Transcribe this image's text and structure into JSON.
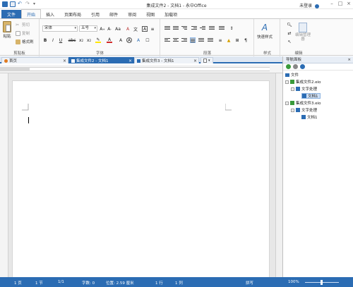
{
  "window": {
    "title": "集成文件2 - 文档1 - 永中Office",
    "user": "未登录"
  },
  "ribbon_tabs": [
    "文件",
    "开始",
    "插入",
    "页面布局",
    "引用",
    "邮件",
    "审阅",
    "视图",
    "加载项"
  ],
  "clipboard": {
    "paste": "粘贴",
    "cut": "剪切",
    "copy": "复制",
    "format_painter": "格式刷",
    "group": "剪贴板"
  },
  "font": {
    "name": "宋体",
    "size": "五号",
    "group": "字体"
  },
  "paragraph_group": "段落",
  "styles": {
    "quick": "快速样式",
    "group": "样式"
  },
  "editing": {
    "edit_mgr": "编辑管理器",
    "group": "编辑"
  },
  "doc_tabs": [
    {
      "label": "首页"
    },
    {
      "label": "集成文件2 - 文档1"
    },
    {
      "label": "集成文件3 - 文档1"
    }
  ],
  "nav": {
    "title": "导航面板",
    "root": "文件",
    "items": [
      "集成文件2.eio",
      "文字处理",
      "文档1",
      "集成文件3.eio",
      "文字处理",
      "文档1"
    ]
  },
  "status": {
    "page": "1 页",
    "section": "1 节",
    "pages": "1/1",
    "words": "字数: 0",
    "position": "位置: 2.59 厘米",
    "line": "1 行",
    "col": "1 列",
    "mode": "拼写",
    "zoom": "100%"
  },
  "colors": {
    "accent": "#2b6cb3",
    "ribbon_bg": "#fafafa",
    "status_bg": "#2b6cb3",
    "highlight": "#ffe600",
    "font_color": "#d22a2a"
  },
  "icons": [
    "save-icon",
    "undo-icon",
    "redo-icon",
    "paste-icon",
    "cut-icon",
    "copy-icon",
    "format-painter-icon",
    "bold-icon",
    "italic-icon",
    "underline-icon",
    "strikethrough-icon",
    "subscript-icon",
    "superscript-icon",
    "highlight-icon",
    "font-color-icon",
    "bullets-icon",
    "numbering-icon",
    "align-left-icon",
    "align-center-icon",
    "align-right-icon",
    "justify-icon",
    "quick-styles-icon",
    "find-icon",
    "replace-icon",
    "select-icon",
    "edit-manager-icon",
    "close-icon",
    "document-icon",
    "home-icon"
  ]
}
